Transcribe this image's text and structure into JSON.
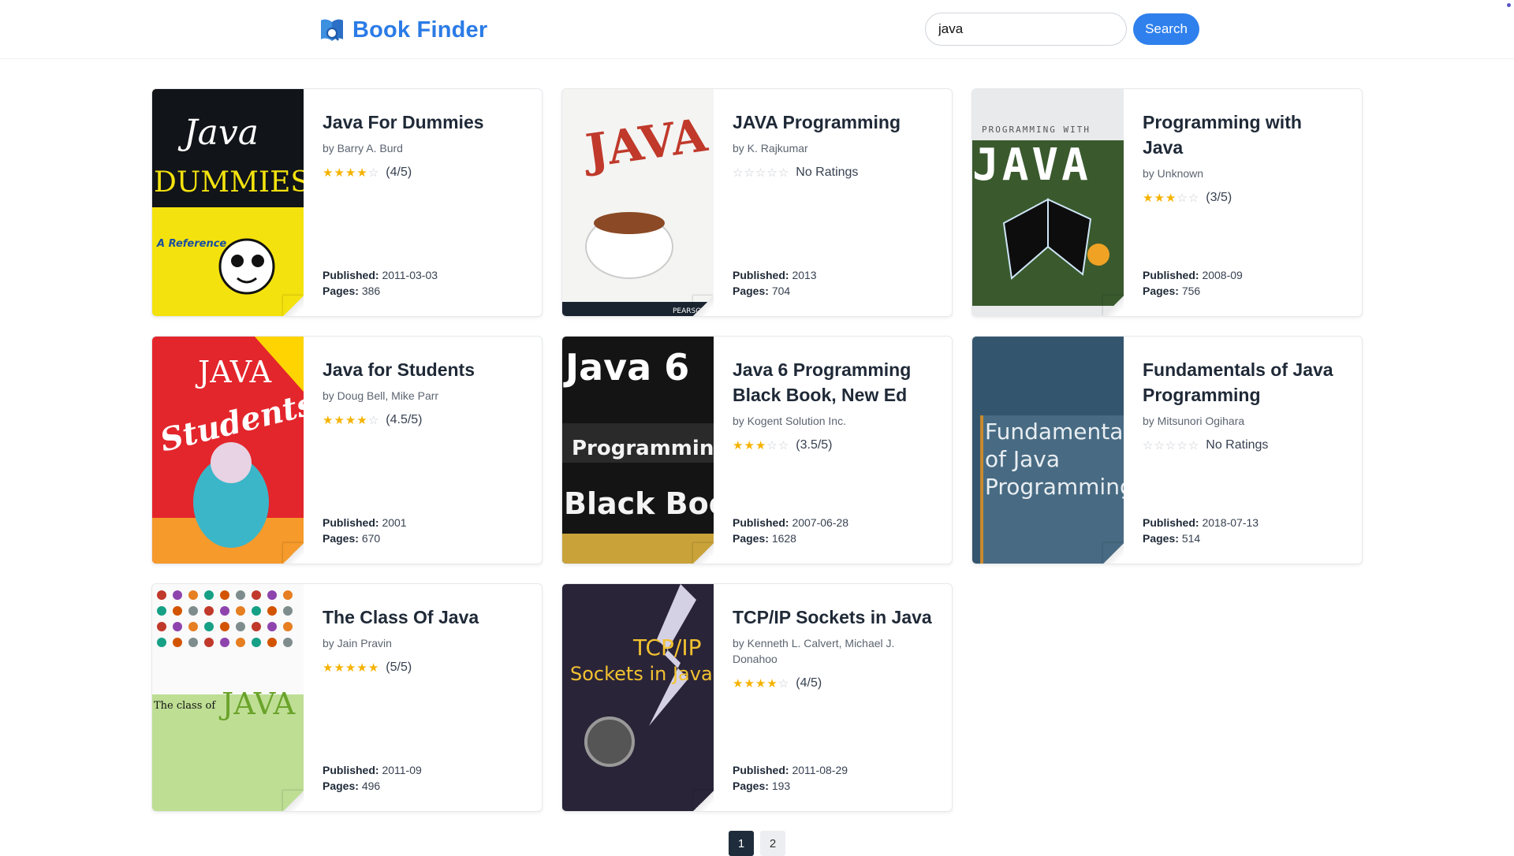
{
  "app": {
    "title": "Book Finder",
    "brand_color": "#2b7be6",
    "logo_icon": "open-book-icon"
  },
  "search": {
    "value": "java",
    "placeholder": "",
    "button_label": "Search"
  },
  "labels": {
    "published": "Published:",
    "pages": "Pages:"
  },
  "books": [
    {
      "title": "Java For Dummies",
      "author": "by Barry A. Burd",
      "rating_stars": 4,
      "rating_text": "(4/5)",
      "published": "2011-03-03",
      "pages": "386",
      "cover": {
        "bg": "#111418",
        "accent": "#f4e20e",
        "line1": "Java",
        "line2": "DUMMIES"
      }
    },
    {
      "title": "JAVA Programming",
      "author": "by K. Rajkumar",
      "rating_stars": 0,
      "rating_text": "No Ratings",
      "published": "2013",
      "pages": "704",
      "cover": {
        "bg": "#f4f4f2",
        "accent": "#c0392b",
        "line1": "JAVA",
        "line2": "PEARSON"
      }
    },
    {
      "title": "Programming with Java",
      "author": "by Unknown",
      "rating_stars": 3,
      "rating_text": "(3/5)",
      "published": "2008-09",
      "pages": "756",
      "cover": {
        "bg": "#e8eaec",
        "accent": "#2d3b2a",
        "line1": "PROGRAMMING WITH",
        "line2": "JAVA"
      }
    },
    {
      "title": "Java for Students",
      "author": "by Doug Bell, Mike Parr",
      "rating_stars": 4,
      "rating_text": "(4.5/5)",
      "published": "2001",
      "pages": "670",
      "cover": {
        "bg": "#e3262c",
        "accent": "#ffd400",
        "line1": "JAVA",
        "line2": "Students"
      }
    },
    {
      "title": "Java 6 Programming Black Book, New Ed",
      "author": "by Kogent Solution Inc.",
      "rating_stars": 3,
      "rating_text": "(3.5/5)",
      "published": "2007-06-28",
      "pages": "1628",
      "cover": {
        "bg": "#141414",
        "accent": "#c9a23a",
        "line1": "Java 6",
        "line2": "Black Book"
      }
    },
    {
      "title": "Fundamentals of Java Programming",
      "author": "by Mitsunori Ogihara",
      "rating_stars": 0,
      "rating_text": "No Ratings",
      "published": "2018-07-13",
      "pages": "514",
      "cover": {
        "bg": "#34556e",
        "accent": "#c98a2c",
        "line1": "Fundamentals",
        "line2": "of Java"
      }
    },
    {
      "title": "The Class Of Java",
      "author": "by Jain Pravin",
      "rating_stars": 5,
      "rating_text": "(5/5)",
      "published": "2011-09",
      "pages": "496",
      "cover": {
        "bg": "#fafafa",
        "accent": "#8cc63f",
        "line1": "The class of",
        "line2": "JAVA"
      }
    },
    {
      "title": "TCP/IP Sockets in Java",
      "author": "by Kenneth L. Calvert, Michael J. Donahoo",
      "rating_stars": 4,
      "rating_text": "(4/5)",
      "published": "2011-08-29",
      "pages": "193",
      "cover": {
        "bg": "#2a2438",
        "accent": "#f2c230",
        "line1": "TCP/IP",
        "line2": "Sockets in Java"
      }
    }
  ],
  "pagination": {
    "pages": [
      "1",
      "2"
    ],
    "current": "1"
  }
}
